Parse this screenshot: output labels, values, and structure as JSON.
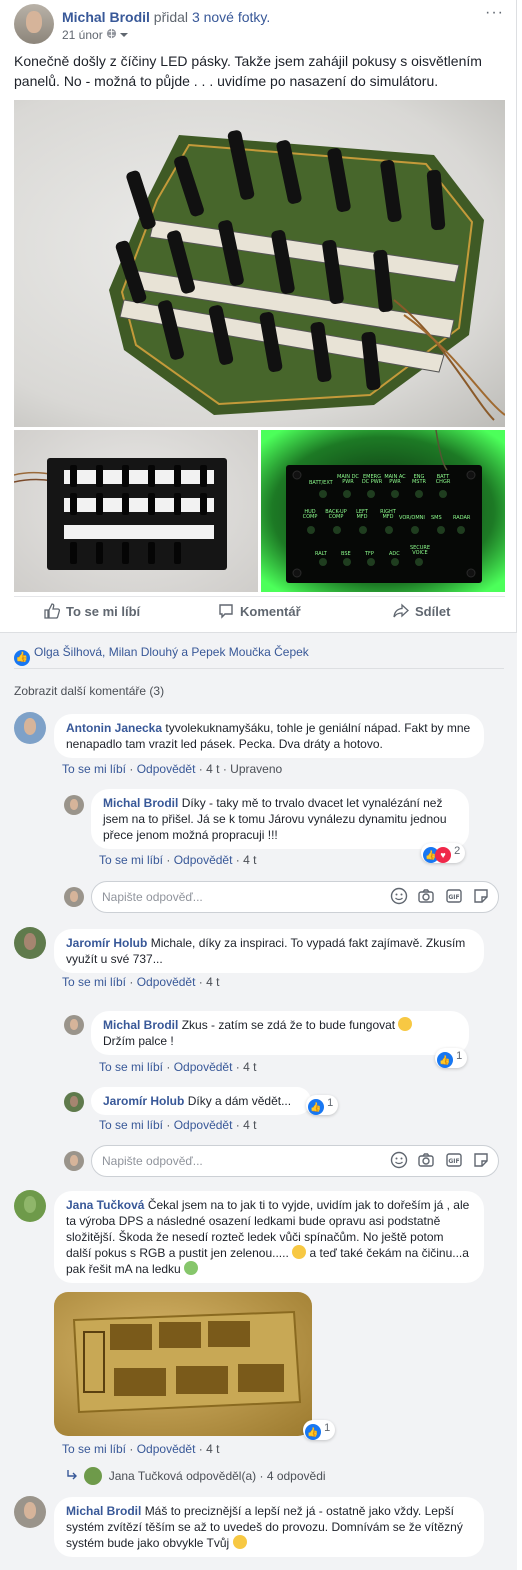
{
  "post": {
    "author": "Michal Brodil",
    "action": "přidal",
    "action_link": "3 nové fotky.",
    "date": "21 únor",
    "more": "···",
    "text": "Konečně došly z číčiny LED pásky. Takže jsem zahájil pokusy s oisvětlením panelů. No - možná to půjde . . . uvidíme po nasazení do simulátoru.",
    "panel_labels": [
      "BATT/EXT",
      "MAIN DC PWR",
      "EMERG DC PWR",
      "MAIN AC PWR",
      "ENG MSTR",
      "BATT CHGR",
      "HUD COMP",
      "BACK-UP COMP",
      "LEFT MFD",
      "RIGHT MFD",
      "VOR/OMNI",
      "SMS",
      "RADAR",
      "RALT",
      "BSE",
      "TFP",
      "ADC",
      "SECURE VOICE"
    ]
  },
  "actions": {
    "like": "To se mi líbí",
    "comment": "Komentář",
    "share": "Sdílet"
  },
  "reactions_summary": "Olga Šilhová, Milan Dlouhý a Pepek Moučka Čepek",
  "more_comments": "Zobrazit další komentáře (3)",
  "labels": {
    "like": "To se mi líbí",
    "reply": "Odpovědět",
    "edited": "Upraveno",
    "reply_placeholder": "Napište odpověď...",
    "dot": "·"
  },
  "comments": [
    {
      "author": "Antonin Janecka",
      "text": "tyvolekuknamyšáku, tohle je geniální nápad. Fakt by mne nenapadlo tam vrazit led pásek. Pecka. Dva dráty a hotovo.",
      "time": "4 t"
    },
    {
      "author": "Michal Brodil",
      "text": "Díky - taky mě to trvalo dvacet let vynalézání než jsem na to přišel. Já se k tomu Járovu vynálezu dynamitu jednou přece jenom možná propracuji !!!",
      "time": "4 t",
      "reactions": "2"
    },
    {
      "author": "Jaromír Holub",
      "text": "Michale, díky za inspiraci. To vypadá fakt zajímavě. Zkusím využít u své 737...",
      "time": "4 t"
    },
    {
      "author": "Michal Brodil",
      "text": "Zkus - zatím se zdá že to bude fungovat",
      "text2": "Držím palce !",
      "time": "4 t",
      "reactions": "1"
    },
    {
      "author": "Jaromír Holub",
      "text": "Díky a dám vědět...",
      "time": "4 t",
      "reactions": "1"
    },
    {
      "author": "Jana Tučková",
      "text": "Čekal jsem na to jak ti to vyjde, uvidím jak to dořeším já , ale ta výroba DPS a následné osazení ledkami bude opravu asi podstatně složitější. Škoda že nesedí rozteč ledek vůči spínačům. No ještě potom další pokus s RGB a pustit jen zelenou.....",
      "text_b": " a teď také čekám na čičinu...a pak řešit mA na ledku",
      "time": "4 t",
      "reactions": "1"
    },
    {
      "author": "Michal Brodil",
      "text": "Máš to preciznější a lepší než já - ostatně jako vždy. Lepší systém zvítězí těším se až to uvedeš do provozu. Domnívám se že vítězný systém bude jako obvykle Tvůj"
    }
  ],
  "thread": {
    "author": "Jana Tučková",
    "action": "odpověděl(a)",
    "count": "4 odpovědi"
  },
  "colors": {
    "link": "#385898",
    "like_blue": "#1877f2",
    "band": "#f2f3f5",
    "led_green": "#4cff5a"
  }
}
